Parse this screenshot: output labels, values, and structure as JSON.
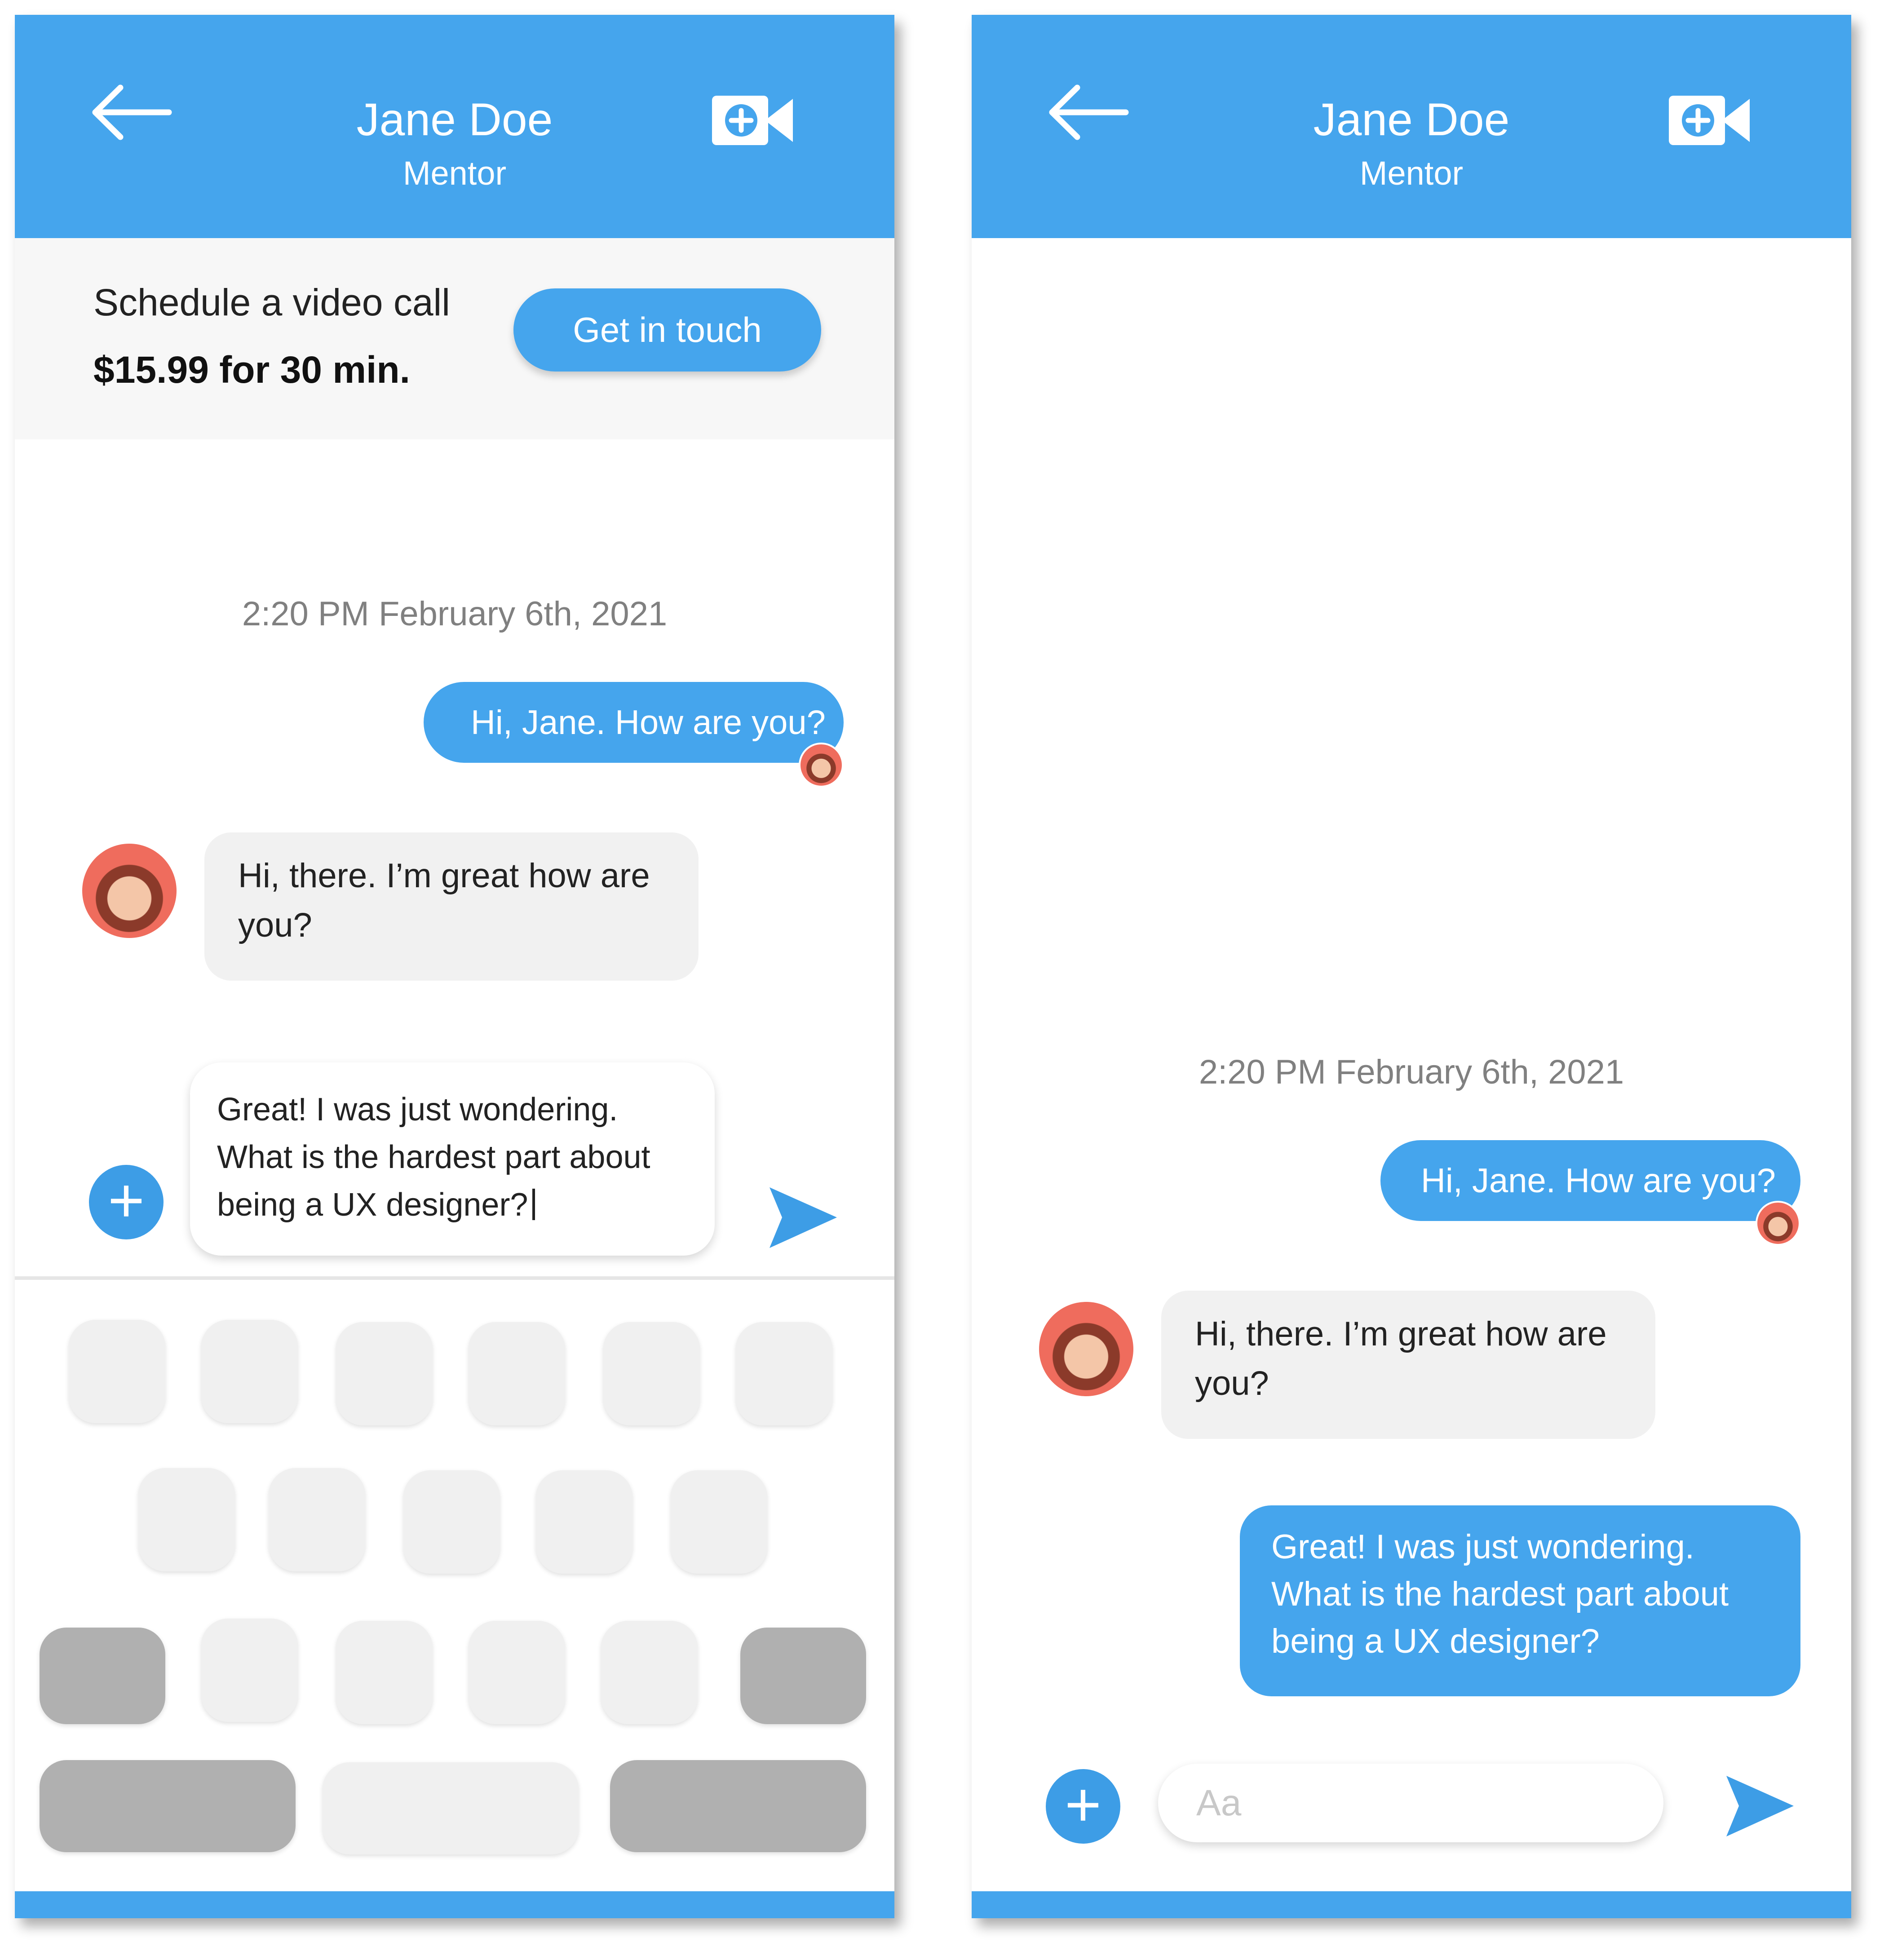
{
  "chat": {
    "contact_name": "Jane Doe",
    "contact_role": "Mentor",
    "timestamp": "2:20 PM February 6th, 2021",
    "messages": [
      {
        "sender": "me",
        "text": "Hi, Jane. How are you?"
      },
      {
        "sender": "contact",
        "text": "Hi, there. I’m great how are you?"
      },
      {
        "sender": "me",
        "text": "Great! I was just wondering. What is the hardest part about being a UX designer?"
      }
    ]
  },
  "schedule": {
    "label": "Schedule a video call",
    "price": "$15.99 for 30 min.",
    "button_label": "Get in touch"
  },
  "composer": {
    "typing_text": "Great! I was just wondering. What is the hardest part about being a UX designer?",
    "placeholder": "Aa"
  },
  "icons": {
    "back": "back-arrow-icon",
    "video": "video-call-icon",
    "add": "plus-icon",
    "send": "send-icon"
  },
  "colors": {
    "accent": "#45a5ed",
    "incoming_bubble": "#f1f1f1",
    "key": "#f0f0f0",
    "key_dark": "#b0b0b0"
  }
}
